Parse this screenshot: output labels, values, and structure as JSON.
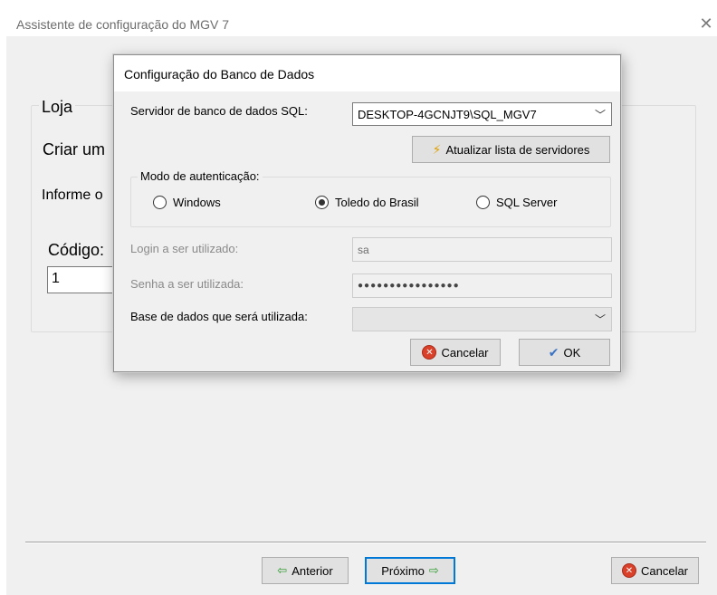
{
  "window": {
    "title": "Assistente de configuração do MGV 7",
    "close_glyph": "✕"
  },
  "background_form": {
    "group_label": "Loja",
    "create_text": "Criar um",
    "info_text": "Informe o",
    "code_label": "Código:",
    "code_value": "1"
  },
  "dialog": {
    "title": "Configuração do Banco de Dados",
    "server_label": "Servidor de banco de dados SQL:",
    "server_value": "DESKTOP-4GCNJT9\\SQL_MGV7",
    "refresh_button": "Atualizar lista de servidores",
    "auth_group_label": "Modo de autenticação:",
    "auth_options": [
      {
        "label": "Windows",
        "checked": false
      },
      {
        "label": "Toledo do Brasil",
        "checked": true
      },
      {
        "label": "SQL Server",
        "checked": false
      }
    ],
    "login_label": "Login a ser utilizado:",
    "login_value": "sa",
    "password_label": "Senha a ser utilizada:",
    "password_value": "●●●●●●●●●●●●●●●●",
    "database_label": "Base de dados que será utilizada:",
    "database_value": "",
    "cancel_button": "Cancelar",
    "ok_button": "OK"
  },
  "footer": {
    "back_button": "Anterior",
    "next_button": "Próximo",
    "cancel_button": "Cancelar"
  },
  "icons": {
    "chevron": "﹀",
    "cancel_glyph": "✕",
    "ok_glyph": "✔",
    "bolt_glyph": "⚡",
    "back_arrow": "⇦",
    "next_arrow": "⇨"
  },
  "colors": {
    "focus_blue": "#0078d7",
    "cancel_red": "#d9412a",
    "arrow_green": "#2f9a2f"
  }
}
